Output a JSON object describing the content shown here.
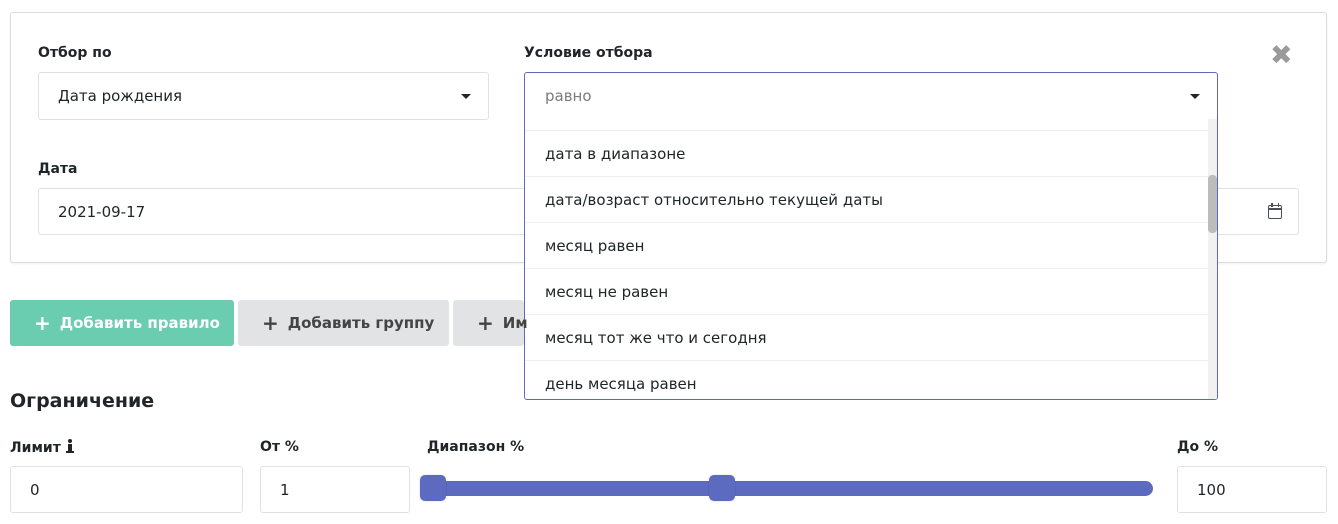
{
  "filter": {
    "field_label": "Отбор по",
    "field_value": "Дата рождения",
    "condition_label": "Условие отбора",
    "condition_value": "равно",
    "date_label": "Дата",
    "date_value": "2021-09-17",
    "close_glyph": "✖"
  },
  "condition_options": [
    "дата в диапазоне",
    "дата/возраст относительно текущей даты",
    "месяц равен",
    "месяц не равен",
    "месяц тот же что и сегодня",
    "день месяца равен"
  ],
  "buttons": {
    "add_rule": "Добавить правило",
    "add_group": "Добавить группу",
    "third_partial": "Им"
  },
  "limit_section": {
    "title": "Ограничение",
    "limit_label": "Лимит",
    "limit_value": "0",
    "from_label": "От %",
    "from_value": "1",
    "range_label": "Диапазон %",
    "to_label": "До %",
    "to_value": "100",
    "slider_low_fraction": 0.0,
    "slider_high_fraction": 0.41
  },
  "colors": {
    "accent": "#5c6bc0",
    "success": "#6acdaf",
    "secondary": "#e2e3e5"
  },
  "icons": {
    "close": "close-icon",
    "caret": "caret-down-icon",
    "calendar": "calendar-icon",
    "plus": "plus-icon",
    "info": "info-icon"
  }
}
